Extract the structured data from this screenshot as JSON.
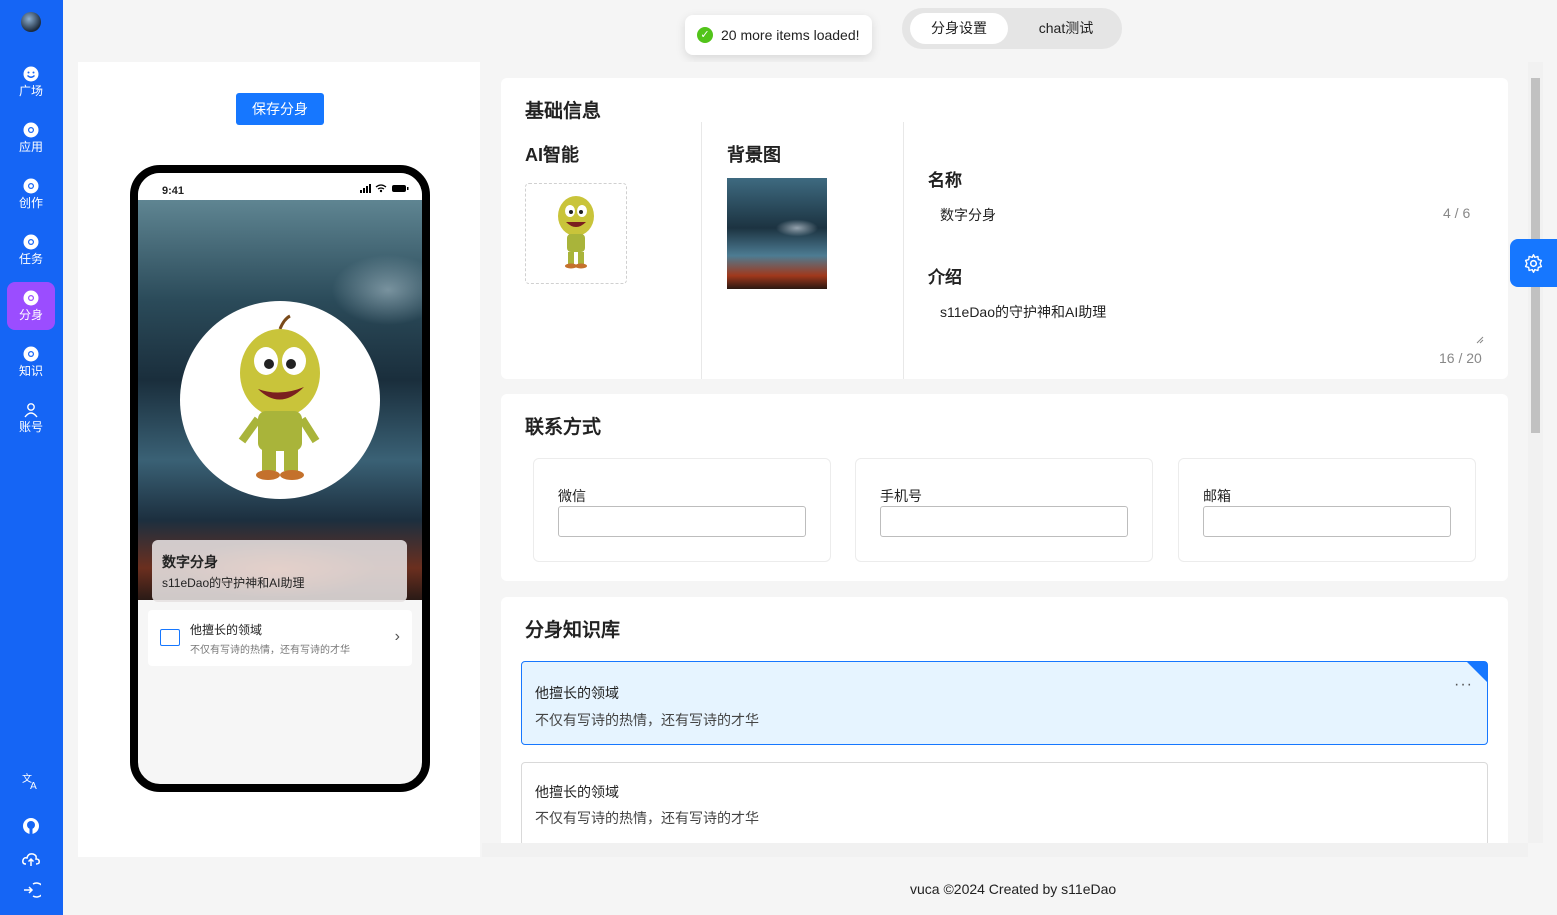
{
  "sidebar": {
    "items": [
      {
        "label": "广场",
        "icon": "smile-icon"
      },
      {
        "label": "应用",
        "icon": "chrome-icon"
      },
      {
        "label": "创作",
        "icon": "chrome-icon"
      },
      {
        "label": "任务",
        "icon": "chrome-icon"
      },
      {
        "label": "分身",
        "icon": "chrome-icon",
        "active": true
      },
      {
        "label": "知识",
        "icon": "chrome-icon"
      },
      {
        "label": "账号",
        "icon": "user-icon"
      }
    ],
    "bottom_icons": [
      "translate-icon",
      "github-icon",
      "cloud-upload-icon",
      "logout-icon"
    ],
    "accent": "#1565f5",
    "active_color": "#9b4dff"
  },
  "toast": {
    "text": "20 more items loaded!"
  },
  "tabs": {
    "settings": "分身设置",
    "chat": "chat测试"
  },
  "preview": {
    "save_label": "保存分身",
    "status_time": "9:41",
    "name": "数字分身",
    "desc": "s11eDao的守护神和AI助理",
    "knowledge_title": "他擅长的领域",
    "knowledge_sub": "不仅有写诗的热情，还有写诗的才华"
  },
  "basic": {
    "title": "基础信息",
    "ai_label": "AI智能",
    "bg_label": "背景图",
    "name_label": "名称",
    "name_value": "数字分身",
    "name_counter": "4 / 6",
    "intro_label": "介绍",
    "intro_value": "s11eDao的守护神和AI助理",
    "intro_counter": "16 / 20"
  },
  "contact": {
    "title": "联系方式",
    "wechat": "微信",
    "phone": "手机号",
    "email": "邮箱"
  },
  "knowledge": {
    "title": "分身知识库",
    "items": [
      {
        "title": "他擅长的领域",
        "sub": "不仅有写诗的热情，还有写诗的才华"
      },
      {
        "title": "他擅长的领域",
        "sub": "不仅有写诗的热情，还有写诗的才华"
      }
    ]
  },
  "footer": "vuca ©2024 Created by s11eDao"
}
